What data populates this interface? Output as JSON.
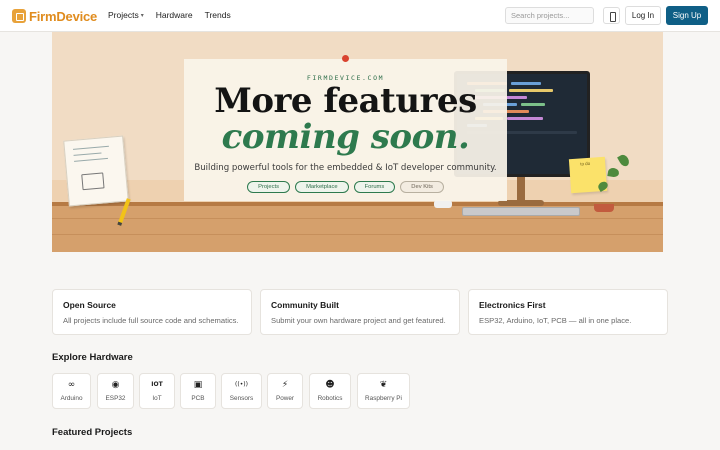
{
  "header": {
    "logo": "FirmDevice",
    "nav": [
      {
        "label": "Projects",
        "has_dropdown": true
      },
      {
        "label": "Hardware"
      },
      {
        "label": "Trends"
      }
    ],
    "search_placeholder": "Search projects...",
    "login_label": "Log In",
    "signup_label": "Sign Up"
  },
  "hero": {
    "eyebrow": "FIRMDEVICE.COM",
    "title_line1": "More features",
    "title_line2": "coming soon.",
    "subtitle": "Building powerful tools for the embedded & IoT developer community.",
    "pills": [
      "Projects",
      "Marketplace",
      "Forums",
      "Dev Kits"
    ],
    "sticky_note": "to do"
  },
  "features": [
    {
      "title": "Open Source",
      "text": "All projects include full source code and schematics."
    },
    {
      "title": "Community Built",
      "text": "Submit your own hardware project and get featured."
    },
    {
      "title": "Electronics First",
      "text": "ESP32, Arduino, IoT, PCB — all in one place."
    }
  ],
  "explore": {
    "title": "Explore Hardware",
    "items": [
      {
        "label": "Arduino",
        "icon": "infinity-icon",
        "glyph": "∞"
      },
      {
        "label": "ESP32",
        "icon": "wifi-icon",
        "glyph": "◉"
      },
      {
        "label": "IoT",
        "icon": "iot-icon",
        "glyph": "IOT"
      },
      {
        "label": "PCB",
        "icon": "pcb-icon",
        "glyph": "▣"
      },
      {
        "label": "Sensors",
        "icon": "sensor-icon",
        "glyph": "((•))"
      },
      {
        "label": "Power",
        "icon": "lightning-icon",
        "glyph": "⚡"
      },
      {
        "label": "Robotics",
        "icon": "robot-icon",
        "glyph": "☻"
      },
      {
        "label": "Raspberry Pi",
        "icon": "raspberry-icon",
        "glyph": "❦"
      }
    ]
  },
  "featured": {
    "title": "Featured Projects"
  },
  "colors": {
    "brand": "#e08c1e",
    "primary_button": "#0f5f86",
    "accent_green": "#2e7a4e"
  }
}
